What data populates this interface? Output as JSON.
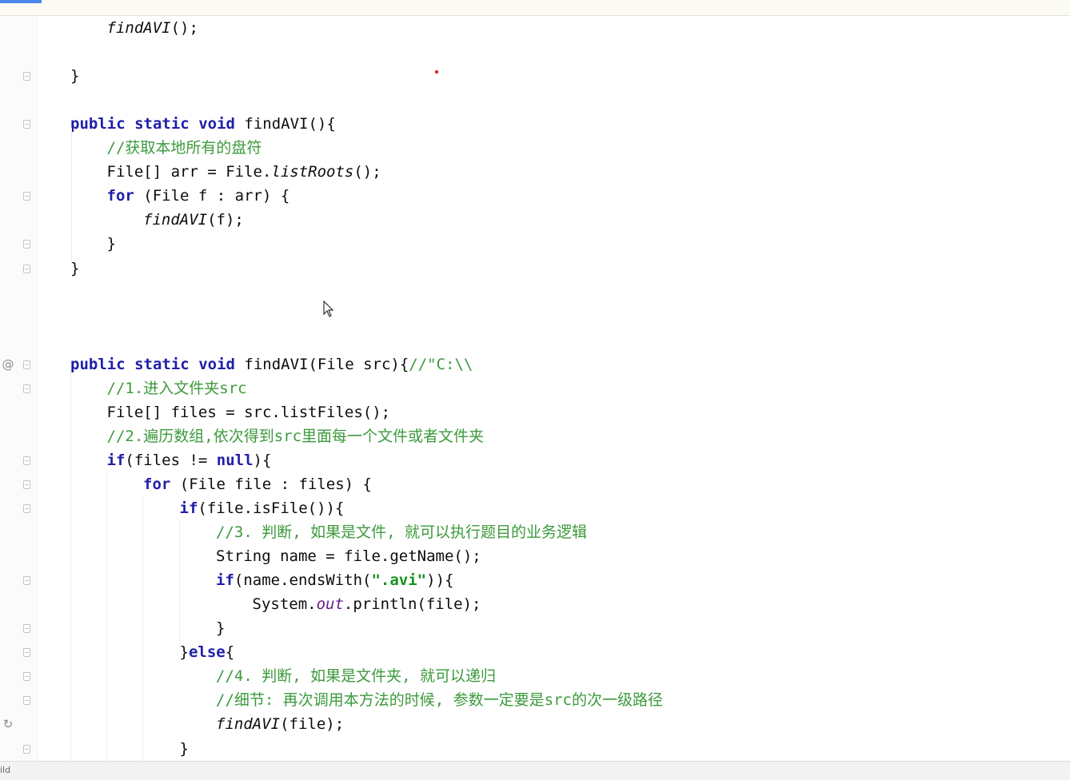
{
  "editor": {
    "lines": [
      {
        "row": 0,
        "indent": 1,
        "tokens": [
          {
            "t": "findAVI",
            "c": "i"
          },
          {
            "t": "();",
            "c": ""
          }
        ]
      },
      {
        "row": 2,
        "indent": 0,
        "tokens": [
          {
            "t": "}",
            "c": ""
          }
        ]
      },
      {
        "row": 4,
        "indent": 0,
        "tokens": [
          {
            "t": "public",
            "c": "k"
          },
          {
            "t": " ",
            "c": ""
          },
          {
            "t": "static",
            "c": "k"
          },
          {
            "t": " ",
            "c": ""
          },
          {
            "t": "void",
            "c": "k"
          },
          {
            "t": " findAVI(){",
            "c": ""
          }
        ]
      },
      {
        "row": 5,
        "indent": 1,
        "tokens": [
          {
            "t": "//获取本地所有的盘符",
            "c": "c"
          }
        ]
      },
      {
        "row": 6,
        "indent": 1,
        "tokens": [
          {
            "t": "File[] arr = File.",
            "c": ""
          },
          {
            "t": "listRoots",
            "c": "i"
          },
          {
            "t": "();",
            "c": ""
          }
        ]
      },
      {
        "row": 7,
        "indent": 1,
        "tokens": [
          {
            "t": "for",
            "c": "k"
          },
          {
            "t": " (File f : arr) {",
            "c": ""
          }
        ]
      },
      {
        "row": 8,
        "indent": 2,
        "tokens": [
          {
            "t": "findAVI",
            "c": "i"
          },
          {
            "t": "(f);",
            "c": ""
          }
        ]
      },
      {
        "row": 9,
        "indent": 1,
        "tokens": [
          {
            "t": "}",
            "c": ""
          }
        ]
      },
      {
        "row": 10,
        "indent": 0,
        "tokens": [
          {
            "t": "}",
            "c": ""
          }
        ]
      },
      {
        "row": 14,
        "indent": 0,
        "tokens": [
          {
            "t": "public",
            "c": "k"
          },
          {
            "t": " ",
            "c": ""
          },
          {
            "t": "static",
            "c": "k"
          },
          {
            "t": " ",
            "c": ""
          },
          {
            "t": "void",
            "c": "k"
          },
          {
            "t": " findAVI(File src){",
            "c": ""
          },
          {
            "t": "//\"C:\\\\",
            "c": "c"
          }
        ]
      },
      {
        "row": 15,
        "indent": 1,
        "tokens": [
          {
            "t": "//1.进入文件夹src",
            "c": "c"
          }
        ]
      },
      {
        "row": 16,
        "indent": 1,
        "tokens": [
          {
            "t": "File[] files = src.listFiles();",
            "c": ""
          }
        ]
      },
      {
        "row": 17,
        "indent": 1,
        "tokens": [
          {
            "t": "//2.遍历数组,依次得到src里面每一个文件或者文件夹",
            "c": "c"
          }
        ]
      },
      {
        "row": 18,
        "indent": 1,
        "tokens": [
          {
            "t": "if",
            "c": "k"
          },
          {
            "t": "(files != ",
            "c": ""
          },
          {
            "t": "null",
            "c": "k"
          },
          {
            "t": "){",
            "c": ""
          }
        ]
      },
      {
        "row": 19,
        "indent": 2,
        "tokens": [
          {
            "t": "for",
            "c": "k"
          },
          {
            "t": " (File file : files) {",
            "c": ""
          }
        ]
      },
      {
        "row": 20,
        "indent": 3,
        "tokens": [
          {
            "t": "if",
            "c": "k"
          },
          {
            "t": "(file.isFile()){",
            "c": ""
          }
        ]
      },
      {
        "row": 21,
        "indent": 4,
        "tokens": [
          {
            "t": "//3. 判断, 如果是文件, 就可以执行题目的业务逻辑",
            "c": "c"
          }
        ]
      },
      {
        "row": 22,
        "indent": 4,
        "tokens": [
          {
            "t": "String name = file.getName();",
            "c": ""
          }
        ]
      },
      {
        "row": 23,
        "indent": 4,
        "tokens": [
          {
            "t": "if",
            "c": "k"
          },
          {
            "t": "(name.endsWith(",
            "c": ""
          },
          {
            "t": "\".avi\"",
            "c": "s"
          },
          {
            "t": ")){",
            "c": ""
          }
        ]
      },
      {
        "row": 24,
        "indent": 5,
        "tokens": [
          {
            "t": "System.",
            "c": ""
          },
          {
            "t": "out",
            "c": "f"
          },
          {
            "t": ".println(file);",
            "c": ""
          }
        ]
      },
      {
        "row": 25,
        "indent": 4,
        "tokens": [
          {
            "t": "}",
            "c": ""
          }
        ]
      },
      {
        "row": 26,
        "indent": 3,
        "tokens": [
          {
            "t": "}",
            "c": ""
          },
          {
            "t": "else",
            "c": "k"
          },
          {
            "t": "{",
            "c": ""
          }
        ]
      },
      {
        "row": 27,
        "indent": 4,
        "tokens": [
          {
            "t": "//4. 判断, 如果是文件夹, 就可以递归",
            "c": "c"
          }
        ]
      },
      {
        "row": 28,
        "indent": 4,
        "tokens": [
          {
            "t": "//细节: 再次调用本方法的时候, 参数一定要是src的次一级路径",
            "c": "c"
          }
        ]
      },
      {
        "row": 29,
        "indent": 4,
        "tokens": [
          {
            "t": "findAVI",
            "c": "i"
          },
          {
            "t": "(file);",
            "c": ""
          }
        ]
      },
      {
        "row": 30,
        "indent": 3,
        "tokens": [
          {
            "t": "}",
            "c": ""
          }
        ]
      }
    ]
  },
  "gutter": {
    "folds": [
      2,
      4,
      7,
      9,
      10,
      14,
      15,
      18,
      19,
      20,
      23,
      25,
      26,
      27,
      28,
      30
    ],
    "markers": [
      {
        "row": 14,
        "glyph": "@",
        "name": "override-marker-icon"
      },
      {
        "row": 29,
        "glyph": "↻",
        "name": "recursive-call-icon"
      }
    ]
  },
  "status": {
    "label": "ild"
  }
}
